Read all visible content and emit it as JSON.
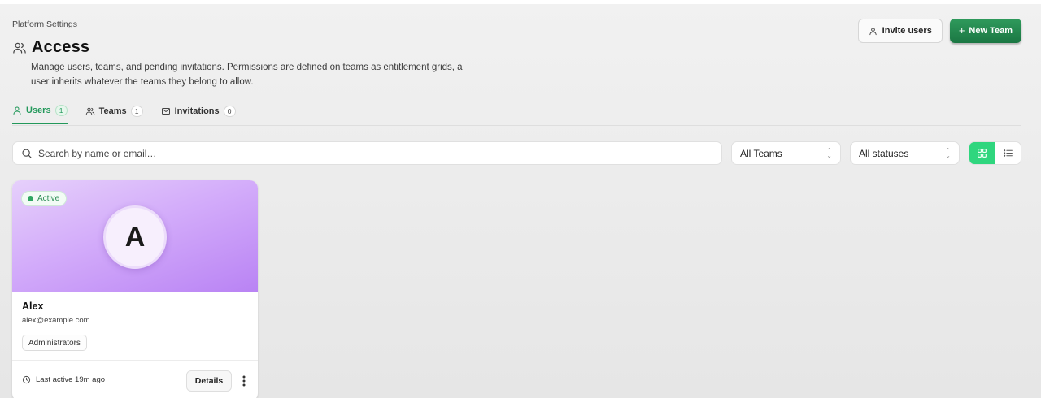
{
  "header": {
    "breadcrumb": "Platform Settings",
    "title": "Access",
    "description": "Manage users, teams, and pending invitations. Permissions are defined on teams as entitlement grids, a user inherits whatever the teams they belong to allow.",
    "title_icon": "users-icon"
  },
  "actions": {
    "invite_label": "Invite users",
    "new_team_label": "New Team",
    "new_team_prefix": "+"
  },
  "tabs": [
    {
      "label": "Users",
      "count": "1",
      "icon": "user-icon",
      "active": true
    },
    {
      "label": "Teams",
      "count": "1",
      "icon": "users-icon",
      "active": false
    },
    {
      "label": "Invitations",
      "count": "0",
      "icon": "mail-icon",
      "active": false
    }
  ],
  "filters": {
    "search_placeholder": "Search by name or email…",
    "teams_value": "All Teams",
    "status_value": "All statuses",
    "view_mode": "grid"
  },
  "users": [
    {
      "status": "Active",
      "initial": "A",
      "name": "Alex",
      "email": "alex@example.com",
      "team": "Administrators",
      "last_active": "Last active 19m ago",
      "details_label": "Details"
    }
  ],
  "colors": {
    "accent": "#22985a",
    "primary_button": "#1b7743",
    "banner_start": "#e6d0fb",
    "banner_end": "#b983f4"
  }
}
